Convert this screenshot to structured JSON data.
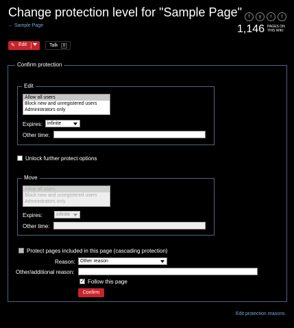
{
  "header": {
    "title": "Change protection level for \"Sample Page\"",
    "back_link": "← Sample Page",
    "pages_count": "1,146",
    "pages_label_line1": "PAGES ON",
    "pages_label_line2": "THIS WIKI",
    "share": [
      "f",
      "y",
      "r",
      "t"
    ]
  },
  "actions": {
    "edit": "Edit",
    "talk": "Talk",
    "talk_count": "0"
  },
  "form": {
    "legend": "Confirm protection",
    "edit_section": {
      "legend": "Edit",
      "options": [
        "Allow all users",
        "Block new and unregistered users",
        "Administrators only"
      ],
      "selected": "Allow all users",
      "expires_label": "Expires:",
      "expires_value": "infinite",
      "other_time_label": "Other time:"
    },
    "unlock_label": "Unlock further protect options",
    "move_section": {
      "legend": "Move",
      "options": [
        "Allow all users",
        "Block new and unregistered users",
        "Administrators only"
      ],
      "selected": "Allow all users",
      "expires_label": "Expires:",
      "expires_value": "infinite",
      "other_time_label": "Other time:"
    },
    "cascade_label": "Protect pages included in this page (cascading protection)",
    "reason_label": "Reason:",
    "reason_value": "Other reason",
    "other_reason_label": "Other/additional reason:",
    "follow_label": "Follow this page",
    "follow_checked": true,
    "confirm": "Confirm"
  },
  "footer": {
    "link": "Edit protection reasons"
  },
  "colors": {
    "background": "#000000",
    "accent_red": "#c8242c",
    "link": "#7aa7e0",
    "fieldset_border": "#4a6a7e"
  }
}
